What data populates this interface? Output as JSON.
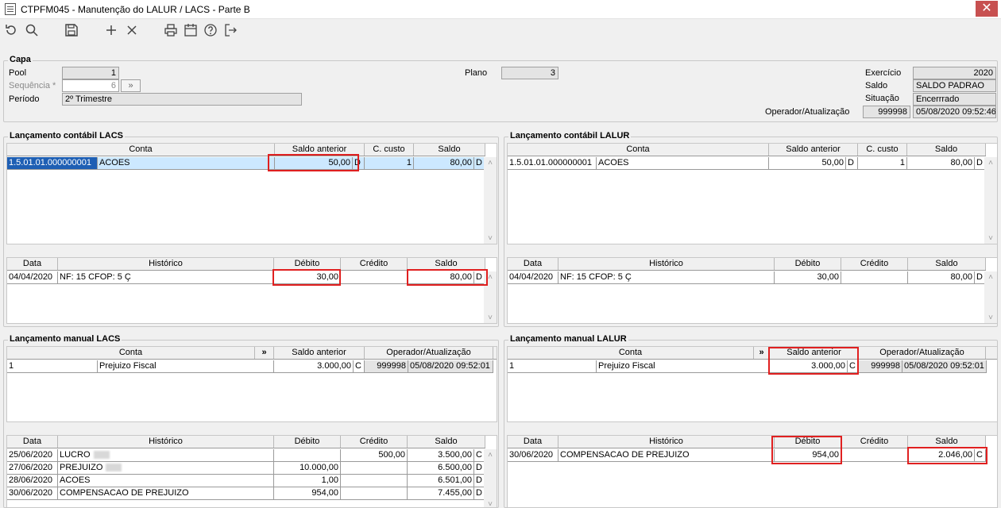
{
  "window": {
    "title": "CTPFM045 - Manutenção do LALUR / LACS - Parte B",
    "close": "✕"
  },
  "capa": {
    "title": "Capa",
    "pool_label": "Pool",
    "pool_value": "1",
    "sequencia_label": "Sequência *",
    "sequencia_value": "6",
    "sequencia_btn": "»",
    "periodo_label": "Período",
    "periodo_value": "2º Trimestre",
    "plano_label": "Plano",
    "plano_value": "3",
    "exercicio_label": "Exercício",
    "exercicio_value": "2020",
    "saldo_label": "Saldo",
    "saldo_value": "SALDO PADRAO",
    "situacao_label": "Situação",
    "situacao_value": "Encerrrado",
    "operador_label": "Operador/Atualização",
    "operador_value": "999998",
    "operador_data": "05/08/2020 09:52:46"
  },
  "lacs_contabil": {
    "title": "Lançamento contábil LACS",
    "headers": {
      "conta": "Conta",
      "saldo_anterior": "Saldo anterior",
      "c_custo": "C. custo",
      "saldo": "Saldo"
    },
    "row": {
      "conta": "1.5.01.01.000000001",
      "descricao": "ACOES",
      "saldo_anterior": "50,00",
      "sa_dc": "D",
      "c_custo": "1",
      "saldo": "80,00",
      "s_dc": "D"
    },
    "mov_headers": {
      "data": "Data",
      "historico": "Histórico",
      "debito": "Débito",
      "credito": "Crédito",
      "saldo": "Saldo"
    },
    "mov": {
      "data": "04/04/2020",
      "historico": "NF: 15 CFOP: 5 Ç",
      "debito": "30,00",
      "credito": "",
      "saldo": "80,00",
      "dc": "D"
    }
  },
  "lalur_contabil": {
    "title": "Lançamento contábil LALUR",
    "headers": {
      "conta": "Conta",
      "saldo_anterior": "Saldo anterior",
      "c_custo": "C. custo",
      "saldo": "Saldo"
    },
    "row": {
      "conta": "1.5.01.01.000000001",
      "descricao": "ACOES",
      "saldo_anterior": "50,00",
      "sa_dc": "D",
      "c_custo": "1",
      "saldo": "80,00",
      "s_dc": "D"
    },
    "mov_headers": {
      "data": "Data",
      "historico": "Histórico",
      "debito": "Débito",
      "credito": "Crédito",
      "saldo": "Saldo"
    },
    "mov": {
      "data": "04/04/2020",
      "historico": "NF: 15 CFOP: 5 Ç",
      "debito": "30,00",
      "credito": "",
      "saldo": "80,00",
      "dc": "D"
    }
  },
  "lacs_manual": {
    "title": "Lançamento manual LACS",
    "headers": {
      "conta": "Conta",
      "expand": "»",
      "saldo_anterior": "Saldo anterior",
      "operador": "Operador/Atualização"
    },
    "row": {
      "conta": "1",
      "descricao": "Prejuizo Fiscal",
      "saldo_anterior": "3.000,00",
      "dc": "C",
      "operador": "999998",
      "data": "05/08/2020 09:52:01"
    },
    "mov_headers": {
      "data": "Data",
      "historico": "Histórico",
      "debito": "Débito",
      "credito": "Crédito",
      "saldo": "Saldo"
    },
    "movs": [
      {
        "data": "25/06/2020",
        "historico": "LUCRO",
        "debito": "",
        "credito": "500,00",
        "saldo": "3.500,00",
        "dc": "C"
      },
      {
        "data": "27/06/2020",
        "historico": "PREJUIZO",
        "debito": "10.000,00",
        "credito": "",
        "saldo": "6.500,00",
        "dc": "D"
      },
      {
        "data": "28/06/2020",
        "historico": "ACOES",
        "debito": "1,00",
        "credito": "",
        "saldo": "6.501,00",
        "dc": "D"
      },
      {
        "data": "30/06/2020",
        "historico": "COMPENSACAO DE PREJUIZO",
        "debito": "954,00",
        "credito": "",
        "saldo": "7.455,00",
        "dc": "D"
      }
    ]
  },
  "lalur_manual": {
    "title": "Lançamento manual LALUR",
    "headers": {
      "conta": "Conta",
      "expand": "»",
      "saldo_anterior": "Saldo anterior",
      "operador": "Operador/Atualização"
    },
    "row": {
      "conta": "1",
      "descricao": "Prejuizo Fiscal",
      "saldo_anterior": "3.000,00",
      "dc": "C",
      "operador": "999998",
      "data": "05/08/2020 09:52:01"
    },
    "mov_headers": {
      "data": "Data",
      "historico": "Histórico",
      "debito": "Débito",
      "credito": "Crédito",
      "saldo": "Saldo"
    },
    "mov": {
      "data": "30/06/2020",
      "historico": "COMPENSACAO DE PREJUIZO",
      "debito": "954,00",
      "credito": "",
      "saldo": "2.046,00",
      "dc": "C"
    }
  },
  "icons": [
    "refresh-icon",
    "search-icon",
    "save-icon",
    "add-icon",
    "delete-icon",
    "print-icon",
    "calendar-icon",
    "help-icon",
    "exit-icon"
  ]
}
